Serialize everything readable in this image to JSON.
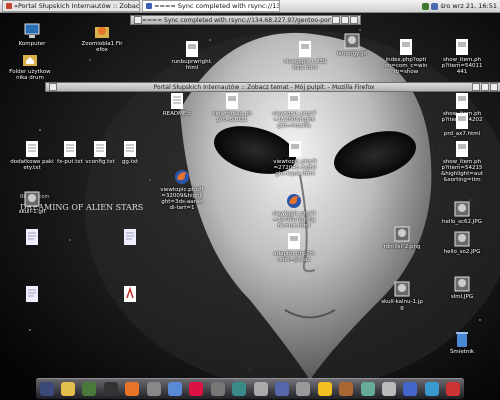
{
  "taskbar": {
    "tasks": [
      {
        "label": "»Portal Słupskich Internautów :: Zobacz tem"
      },
      {
        "label": "==== Sync completed with rsync://134.68.22"
      }
    ],
    "clock": "śro wrz 21, 16:51"
  },
  "windows": [
    {
      "title": "==== Sync completed with rsync://134.68.227.97/gentoo-portage"
    },
    {
      "title": "Portal Słupskich Internautów :: Zobacz temat - Mój pulpit. - Mozilla Firefox"
    }
  ],
  "desktop_icons": [
    {
      "label": "Komputer",
      "icon": "computer-icon"
    },
    {
      "label": "Zoomiobla1 Firefox",
      "icon": "firefox-folder-icon"
    },
    {
      "label": "Folder użytkownika drum",
      "icon": "home-folder-icon"
    },
    {
      "label": "runbuprwright.html",
      "icon": "html-file-icon"
    },
    {
      "label": "viewtopic-t-339035.html",
      "icon": "html-file-icon"
    },
    {
      "label": "lemergy.gif",
      "icon": "image-file-icon"
    },
    {
      "label": "index.php?option=com_c=wintb=show",
      "icon": "html-file-icon"
    },
    {
      "label": "show_item.php?item=54011441",
      "icon": "html-file-icon"
    },
    {
      "label": "README.c",
      "icon": "text-file-icon"
    },
    {
      "label": "viewthread.php?t=51021",
      "icon": "html-file-icon"
    },
    {
      "label": "viewtopic.php?f=15280&highlight=mozilla",
      "icon": "html-file-icon"
    },
    {
      "label": "show_item.php?item=54202270",
      "icon": "html-file-icon"
    },
    {
      "label": "prd_ax7.html",
      "icon": "html-file-icon"
    },
    {
      "label": "dodatkowe pakiety.txt",
      "icon": "text-file-icon"
    },
    {
      "label": "fx-put.txt",
      "icon": "text-file-icon"
    },
    {
      "label": "vconfig.txt",
      "icon": "text-file-icon"
    },
    {
      "label": "gg.txt",
      "icon": "text-file-icon"
    },
    {
      "label": "viewtopic.php?t=272045-highlight-tvpol.html",
      "icon": "html-file-icon"
    },
    {
      "label": "show_item.php?item=54215&highlight=aut&sorting=tim",
      "icon": "html-file-icon"
    },
    {
      "label": "viewtopic.php?t=32009&highlight=3ds-aaraddi-tart=1",
      "icon": "firefox-file-icon"
    },
    {
      "label": "skull-1.gif",
      "icon": "image-file-icon"
    },
    {
      "label": "viewtopic.php?t=33709-highlight-mut.html",
      "icon": "firefox-file-icon"
    },
    {
      "label": "hello_sc62.JPG",
      "icon": "image-file-icon"
    },
    {
      "label": "rdmilsi_2.png",
      "icon": "image-file-icon"
    },
    {
      "label": "hello_so2.JPG",
      "icon": "image-file-icon"
    },
    {
      "label": "adapter.php?model=pxkaz",
      "icon": "html-file-icon"
    },
    {
      "label": "",
      "icon": "document-icon"
    },
    {
      "label": "",
      "icon": "document-icon"
    },
    {
      "label": "",
      "icon": "document-icon"
    },
    {
      "label": "",
      "icon": "pdf-icon"
    },
    {
      "label": "skull-kalnu-1.jpg",
      "icon": "image-file-icon"
    },
    {
      "label": "slml.JPG",
      "icon": "image-file-icon"
    },
    {
      "label": "Śmietnik",
      "icon": "trash-icon"
    }
  ],
  "wallpaper_text": "DREAMING OF ALIEN STARS",
  "wallpaper_site": "Bisquit.com",
  "dock": {
    "items": [
      "home-icon",
      "gimp-icon",
      "mail-icon",
      "terminal-icon",
      "firefox-icon",
      "tool-icon",
      "chat-icon",
      "clock-icon",
      "settings-icon",
      "network-icon",
      "monitor-icon",
      "disk-icon",
      "audio-icon",
      "play-icon",
      "tools-icon",
      "paint-icon",
      "speaker-icon",
      "screen-icon",
      "globe-icon",
      "exit-icon"
    ]
  },
  "colors": {
    "accent": "#c4452c",
    "panel": "#dcdcdc",
    "dock": "#4a4a5a"
  }
}
